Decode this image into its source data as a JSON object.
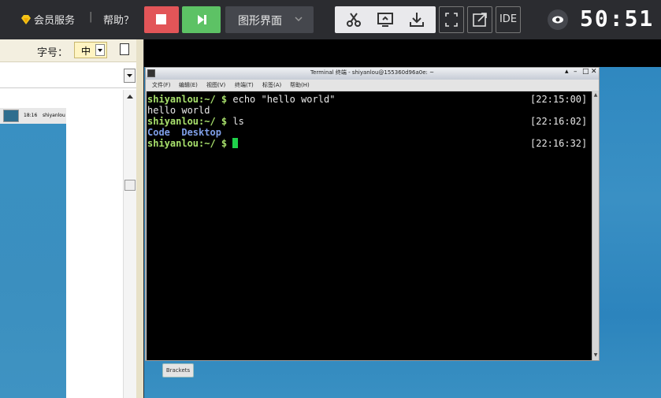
{
  "topbar": {
    "vip_label": "会员服务",
    "separator": "|",
    "help_label": "帮助？",
    "mode_label": "图形界面",
    "ide_label": "IDE",
    "timer": "50:51",
    "accent": {
      "stop": "#e25558",
      "next": "#5dc265"
    }
  },
  "left_panel": {
    "font_size_label": "字号：",
    "font_size_value": "中",
    "taskbar_time": "18:16",
    "taskbar_user": "shiyanlou"
  },
  "terminal": {
    "title": "Terminal 终端 - shiyanlou@155360d96a0e: ~",
    "menu": [
      "文件(F)",
      "编辑(E)",
      "视图(V)",
      "终端(T)",
      "标签(A)",
      "帮助(H)"
    ],
    "lines": [
      {
        "prompt": "shiyanlou:~/ $ ",
        "cmd": "echo \"hello world\"",
        "time": "[22:15:00]"
      },
      {
        "output": "hello world"
      },
      {
        "prompt": "shiyanlou:~/ $ ",
        "cmd": "ls",
        "time": "[22:16:02]"
      },
      {
        "dirs": "Code  Desktop"
      },
      {
        "prompt": "shiyanlou:~/ $ ",
        "cmd": "",
        "time": "[22:16:32]"
      }
    ]
  },
  "desktop": {
    "brackets_label": "Brackets"
  }
}
